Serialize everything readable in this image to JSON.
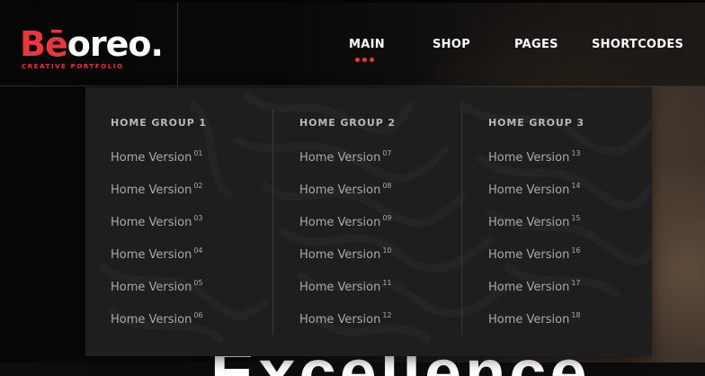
{
  "brand": {
    "logo_prefix": "Bē",
    "logo_suffix": "oreo.",
    "tagline": "CREATIVE PORTFOLIO",
    "accent_color": "#e8383d"
  },
  "nav": {
    "items": [
      {
        "label": "MAIN",
        "active": true
      },
      {
        "label": "SHOP"
      },
      {
        "label": "PAGES"
      },
      {
        "label": "SHORTCODES"
      }
    ]
  },
  "hero": {
    "headline": "Excellence"
  },
  "mega_menu": {
    "groups": [
      {
        "title": "HOME GROUP 1",
        "items": [
          {
            "label": "Home Version",
            "num": "01"
          },
          {
            "label": "Home Version",
            "num": "02"
          },
          {
            "label": "Home Version",
            "num": "03"
          },
          {
            "label": "Home Version",
            "num": "04"
          },
          {
            "label": "Home Version",
            "num": "05"
          },
          {
            "label": "Home Version",
            "num": "06"
          }
        ]
      },
      {
        "title": "HOME GROUP 2",
        "items": [
          {
            "label": "Home Version",
            "num": "07"
          },
          {
            "label": "Home Version",
            "num": "08"
          },
          {
            "label": "Home Version",
            "num": "09"
          },
          {
            "label": "Home Version",
            "num": "10"
          },
          {
            "label": "Home Version",
            "num": "11"
          },
          {
            "label": "Home Version",
            "num": "12"
          }
        ]
      },
      {
        "title": "HOME GROUP 3",
        "items": [
          {
            "label": "Home Version",
            "num": "13"
          },
          {
            "label": "Home Version",
            "num": "14"
          },
          {
            "label": "Home Version",
            "num": "15"
          },
          {
            "label": "Home Version",
            "num": "16"
          },
          {
            "label": "Home Version",
            "num": "17"
          },
          {
            "label": "Home Version",
            "num": "18"
          }
        ]
      }
    ]
  }
}
